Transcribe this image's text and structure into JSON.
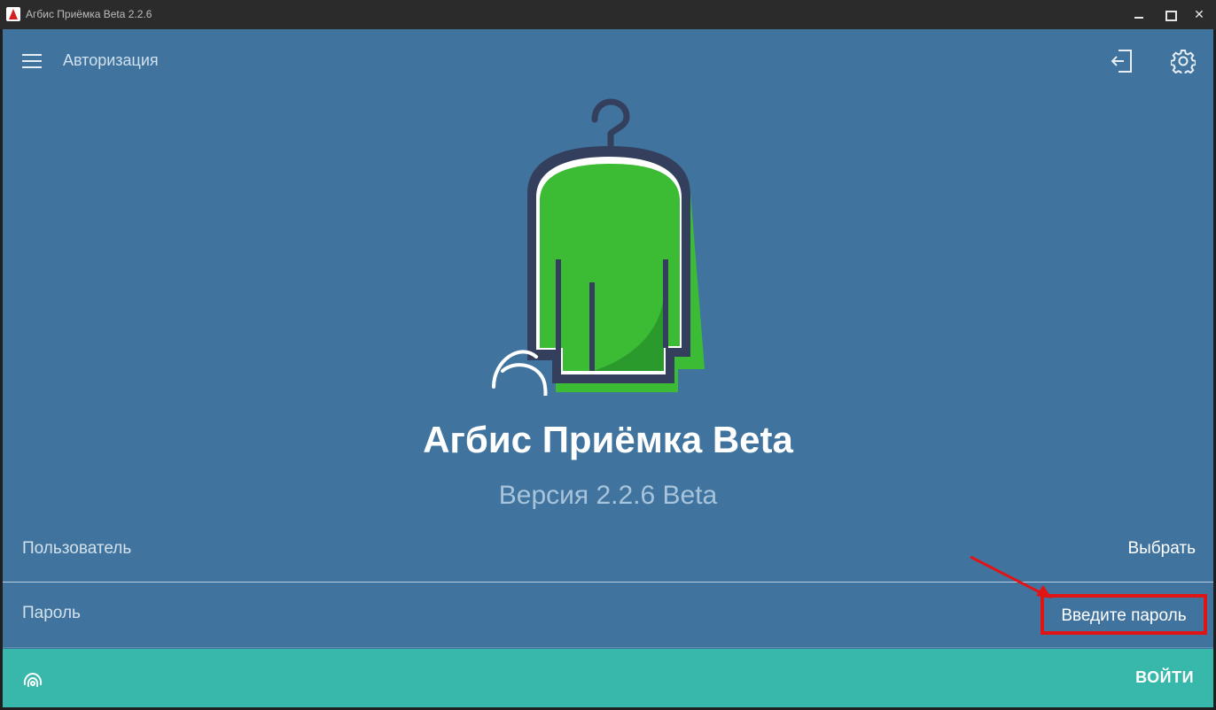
{
  "window": {
    "title": "Агбис Приёмка Beta 2.2.6",
    "minimize_icon": "minimize-icon",
    "maximize_icon": "maximize-icon",
    "close_glyph": "✕"
  },
  "appbar": {
    "title": "Авторизация",
    "menu_icon": "hamburger-menu-icon",
    "exit_icon": "exit-door-icon",
    "settings_icon": "gear-icon"
  },
  "logo": {
    "icon": "garment-on-hanger-icon"
  },
  "brand": {
    "name": "Агбис Приёмка Beta",
    "version": "Версия 2.2.6 Beta"
  },
  "form": {
    "user_label": "Пользователь",
    "user_value": "Выбрать",
    "password_label": "Пароль",
    "password_placeholder": "Введите пароль"
  },
  "bottom_bar": {
    "login_label": "ВОЙТИ",
    "fingerprint_icon": "fingerprint-icon"
  },
  "colors": {
    "background": "#40749e",
    "accent_bar": "#37b8ab",
    "logo_green": "#3cbc35",
    "highlight_red": "#e01414"
  }
}
